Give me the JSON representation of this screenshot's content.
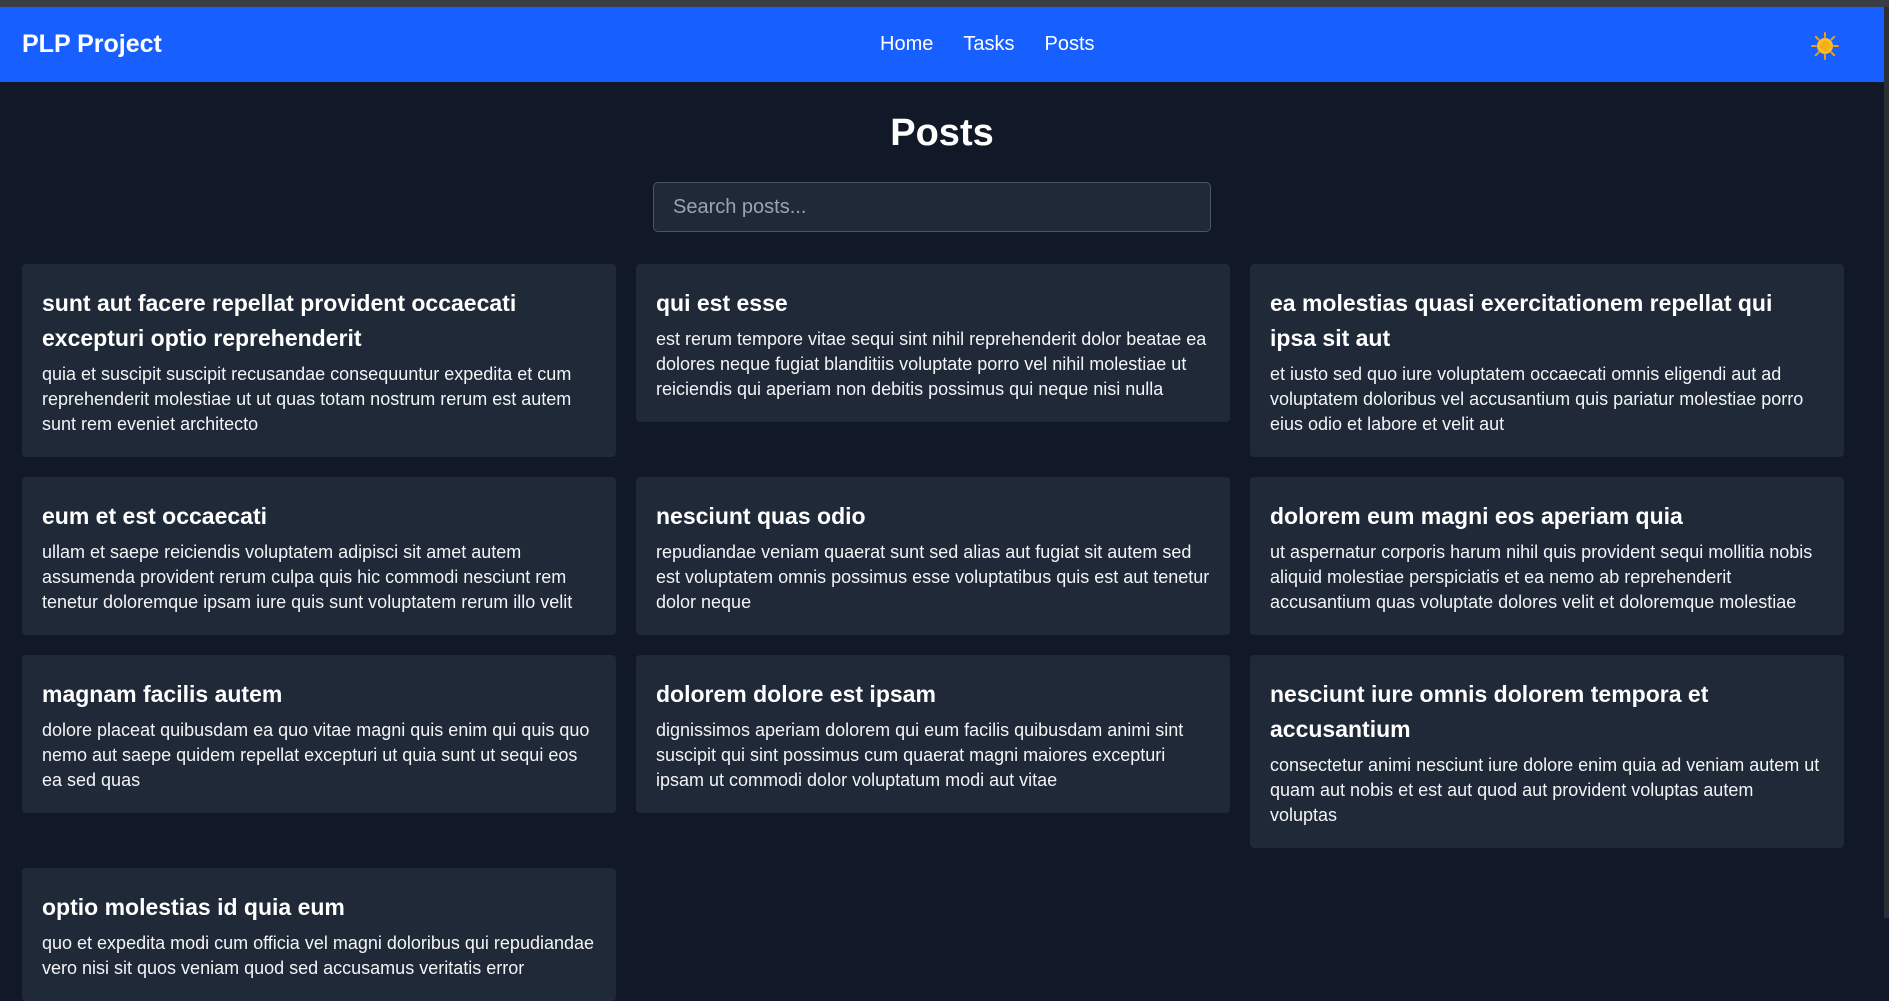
{
  "app": {
    "brand": "PLP Project",
    "nav": [
      "Home",
      "Tasks",
      "Posts"
    ],
    "theme_icon": "sun-icon"
  },
  "page": {
    "title": "Posts",
    "search_placeholder": "Search posts..."
  },
  "posts": [
    {
      "title": "sunt aut facere repellat provident occaecati excepturi optio reprehenderit",
      "body": "quia et suscipit suscipit recusandae consequuntur expedita et cum reprehenderit molestiae ut ut quas totam nostrum rerum est autem sunt rem eveniet architecto"
    },
    {
      "title": "qui est esse",
      "body": "est rerum tempore vitae sequi sint nihil reprehenderit dolor beatae ea dolores neque fugiat blanditiis voluptate porro vel nihil molestiae ut reiciendis qui aperiam non debitis possimus qui neque nisi nulla"
    },
    {
      "title": "ea molestias quasi exercitationem repellat qui ipsa sit aut",
      "body": "et iusto sed quo iure voluptatem occaecati omnis eligendi aut ad voluptatem doloribus vel accusantium quis pariatur molestiae porro eius odio et labore et velit aut"
    },
    {
      "title": "eum et est occaecati",
      "body": "ullam et saepe reiciendis voluptatem adipisci sit amet autem assumenda provident rerum culpa quis hic commodi nesciunt rem tenetur doloremque ipsam iure quis sunt voluptatem rerum illo velit"
    },
    {
      "title": "nesciunt quas odio",
      "body": "repudiandae veniam quaerat sunt sed alias aut fugiat sit autem sed est voluptatem omnis possimus esse voluptatibus quis est aut tenetur dolor neque"
    },
    {
      "title": "dolorem eum magni eos aperiam quia",
      "body": "ut aspernatur corporis harum nihil quis provident sequi mollitia nobis aliquid molestiae perspiciatis et ea nemo ab reprehenderit accusantium quas voluptate dolores velit et doloremque molestiae"
    },
    {
      "title": "magnam facilis autem",
      "body": "dolore placeat quibusdam ea quo vitae magni quis enim qui quis quo nemo aut saepe quidem repellat excepturi ut quia sunt ut sequi eos ea sed quas"
    },
    {
      "title": "dolorem dolore est ipsam",
      "body": "dignissimos aperiam dolorem qui eum facilis quibusdam animi sint suscipit qui sint possimus cum quaerat magni maiores excepturi ipsam ut commodi dolor voluptatum modi aut vitae"
    },
    {
      "title": "nesciunt iure omnis dolorem tempora et accusantium",
      "body": "consectetur animi nesciunt iure dolore enim quia ad veniam autem ut quam aut nobis et est aut quod aut provident voluptas autem voluptas"
    },
    {
      "title": "optio molestias id quia eum",
      "body": "quo et expedita modi cum officia vel magni doloribus qui repudiandae vero nisi sit quos veniam quod sed accusamus veritatis error"
    }
  ]
}
